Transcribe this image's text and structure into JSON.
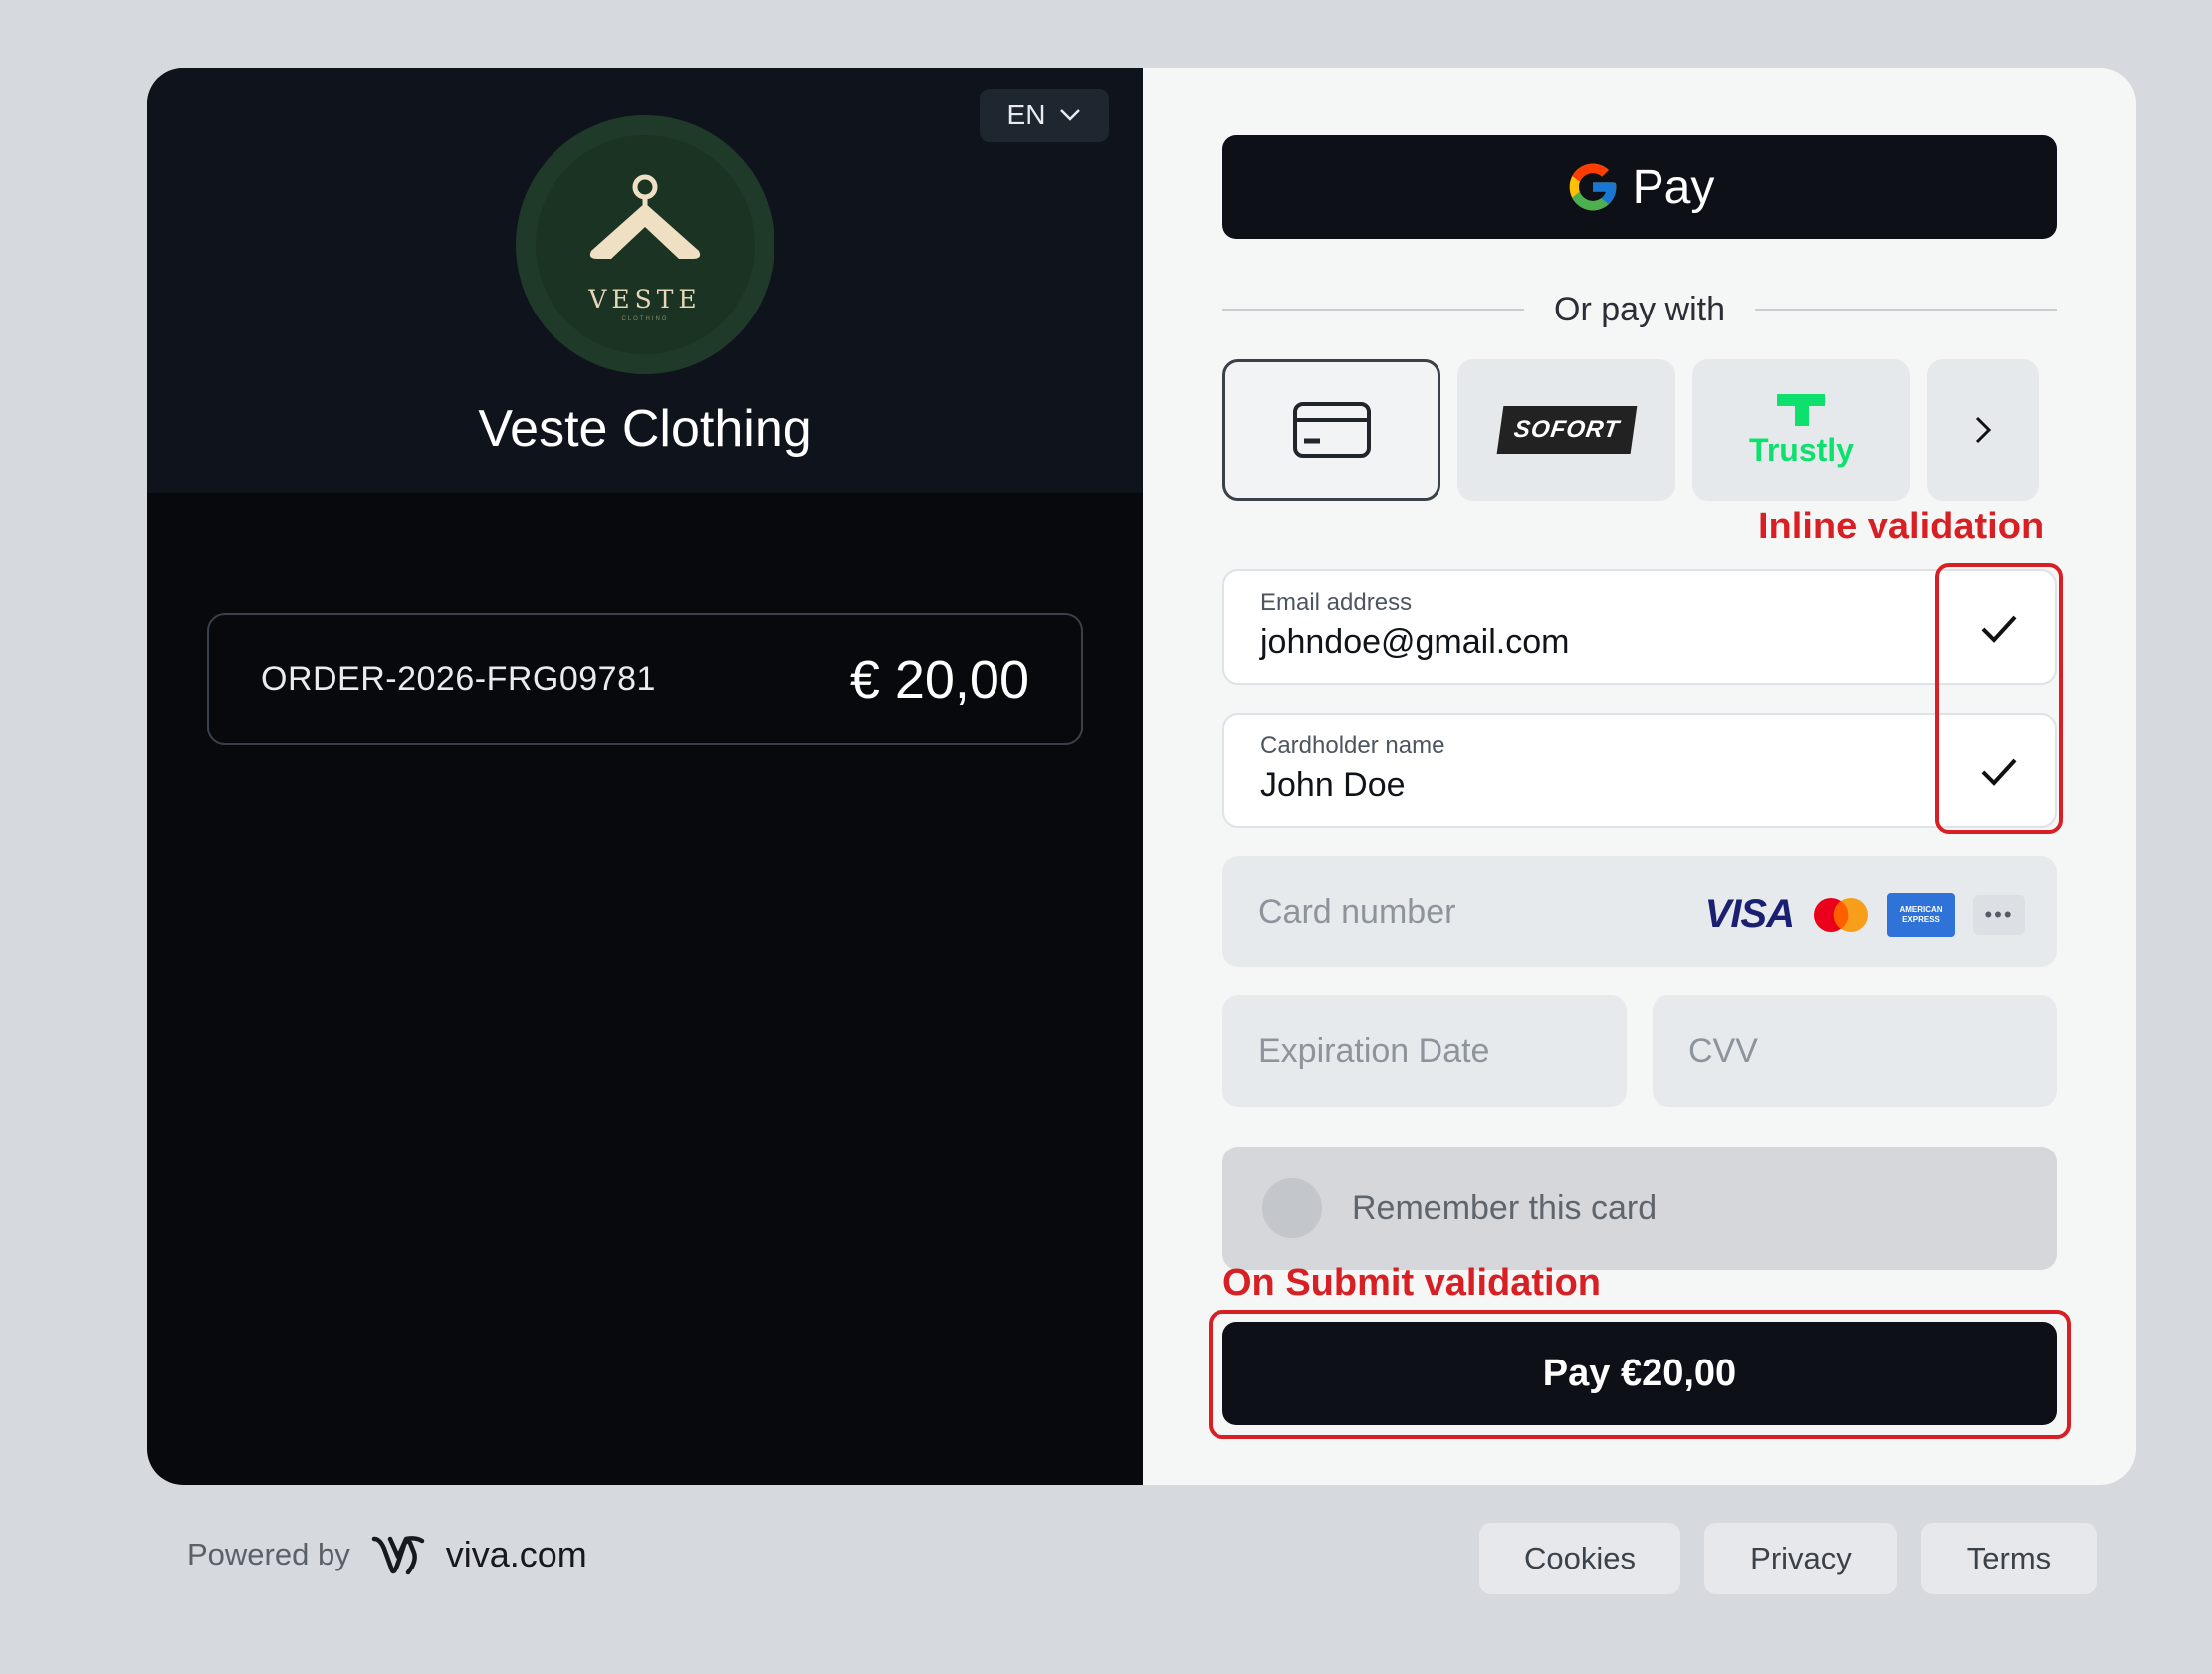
{
  "merchant": {
    "name": "Veste Clothing",
    "logo_text": "VESTE",
    "logo_subtext": "CLOTHING",
    "language": "EN"
  },
  "order": {
    "id": "ORDER-2026-FRG09781",
    "amount": "€ 20,00"
  },
  "payment": {
    "gpay_label": "Pay",
    "divider_text": "Or pay with",
    "methods": [
      {
        "name": "card",
        "icon": "credit-card-icon",
        "active": true
      },
      {
        "name": "sofort",
        "label": "SOFORT"
      },
      {
        "name": "trustly",
        "label": "Trustly"
      },
      {
        "name": "more",
        "icon": "chevron-right-icon"
      }
    ],
    "email_label": "Email address",
    "email_value": "johndoe@gmail.com",
    "cardholder_label": "Cardholder name",
    "cardholder_value": "John Doe",
    "card_number_placeholder": "Card number",
    "card_brands": [
      "VISA",
      "Mastercard",
      "AMERICAN EXPRESS",
      "more"
    ],
    "amex_line1": "AMERICAN",
    "amex_line2": "EXPRESS",
    "more_dots": "•••",
    "expiration_placeholder": "Expiration Date",
    "cvv_placeholder": "CVV",
    "remember_label": "Remember this card",
    "pay_button": "Pay €20,00"
  },
  "annotations": {
    "inline": "Inline validation",
    "submit": "On Submit validation",
    "color": "#d71f24"
  },
  "footer": {
    "powered_by": "Powered by",
    "brand": "viva.com",
    "links": [
      "Cookies",
      "Privacy",
      "Terms"
    ]
  }
}
